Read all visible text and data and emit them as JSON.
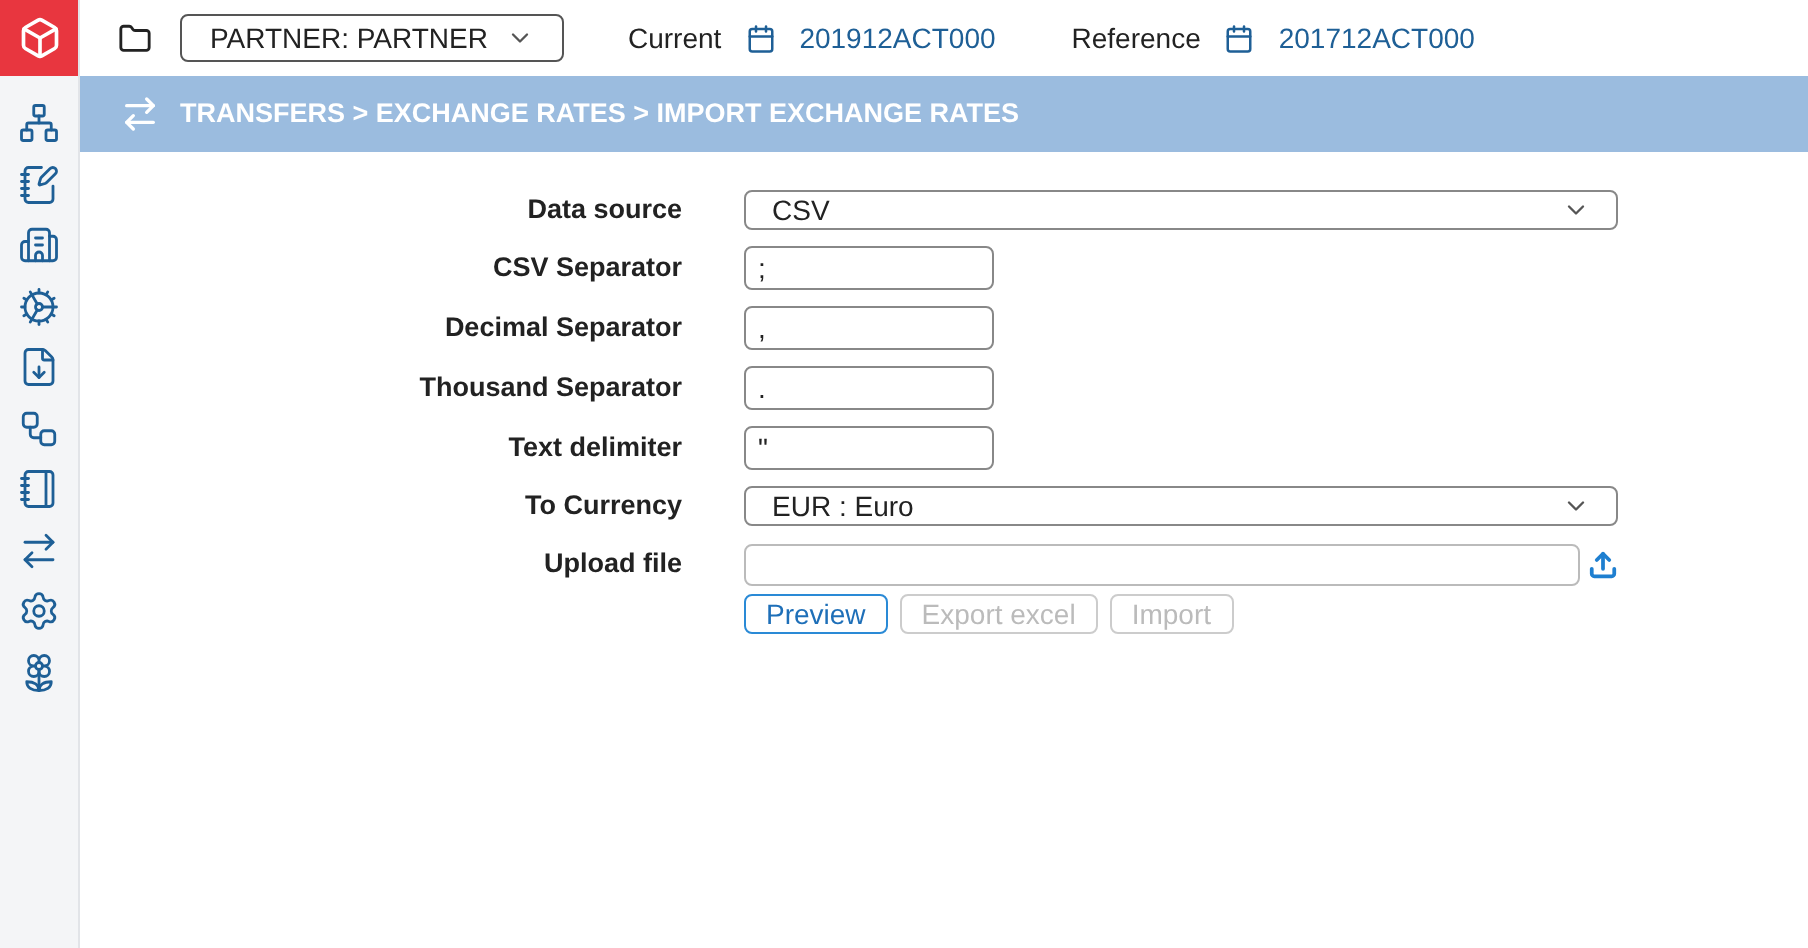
{
  "header": {
    "partner": "PARTNER: PARTNER",
    "current_label": "Current",
    "current_value": "201912ACT000",
    "reference_label": "Reference",
    "reference_value": "201712ACT000"
  },
  "breadcrumb": "TRANSFERS > EXCHANGE RATES > IMPORT EXCHANGE RATES",
  "form": [
    {
      "kind": "select",
      "label": "Data source",
      "value": "CSV"
    },
    {
      "kind": "text",
      "label": "CSV Separator",
      "value": ";"
    },
    {
      "kind": "text",
      "label": "Decimal Separator",
      "value": ","
    },
    {
      "kind": "text",
      "label": "Thousand Separator",
      "value": "."
    },
    {
      "kind": "text",
      "label": "Text delimiter",
      "value": "\""
    },
    {
      "kind": "select",
      "label": "To Currency",
      "value": "EUR : Euro"
    },
    {
      "kind": "file",
      "label": "Upload file"
    }
  ],
  "buttons": [
    {
      "label": "Preview",
      "disabled": false
    },
    {
      "label": "Export excel",
      "disabled": true
    },
    {
      "label": "Import",
      "disabled": true
    }
  ]
}
